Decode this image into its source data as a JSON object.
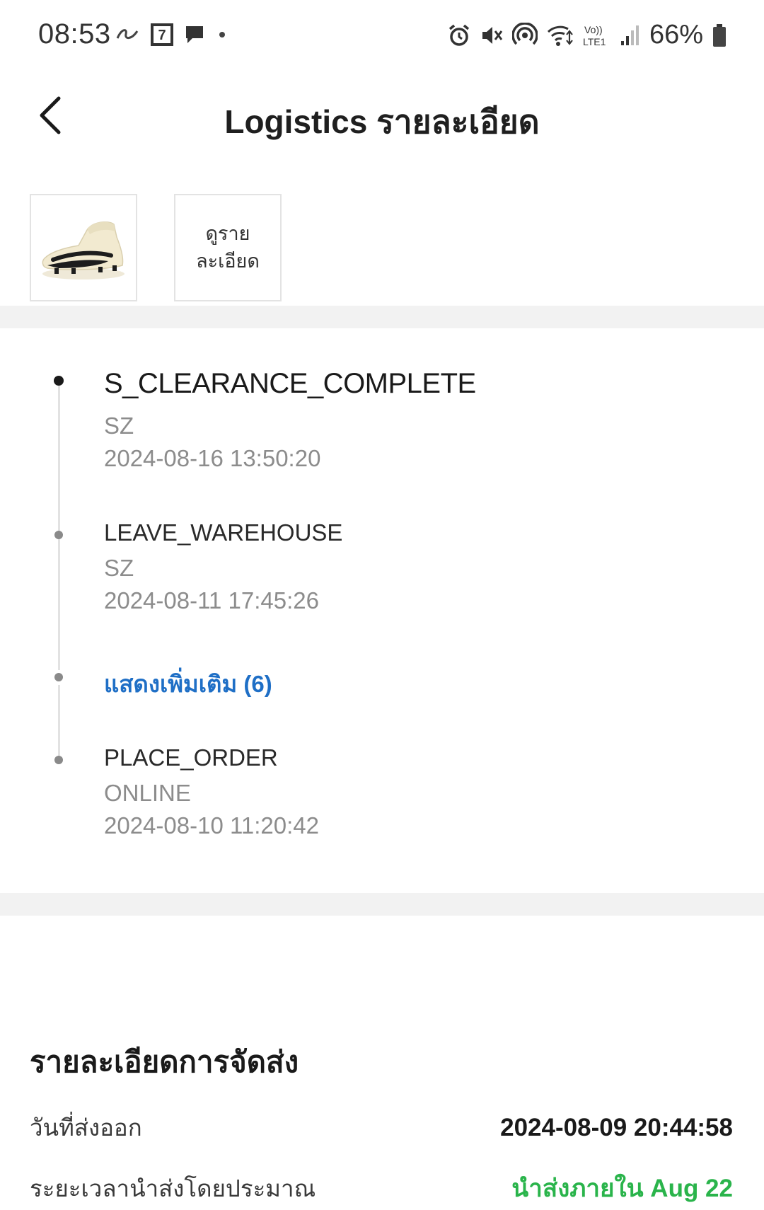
{
  "status_bar": {
    "time": "08:53",
    "battery": "66%",
    "left_icons": [
      "link-icon",
      "seven-eleven-icon",
      "chat-bubble-icon",
      "dot-icon"
    ],
    "right_icons": [
      "alarm-icon",
      "mute-icon",
      "hotspot-icon",
      "wifi-icon",
      "volte-icon",
      "signal-icon",
      "battery-icon"
    ],
    "volte_text": "Vo)) LTE1"
  },
  "header": {
    "title": "Logistics รายละเอียด"
  },
  "product": {
    "thumbnail_alt": "football boot",
    "view_details_label": "ดูรายละเอียด"
  },
  "timeline": {
    "events": [
      {
        "status": "S_CLEARANCE_COMPLETE",
        "location": "SZ",
        "time": "2024-08-16 13:50:20"
      },
      {
        "status": "LEAVE_WAREHOUSE",
        "location": "SZ",
        "time": "2024-08-11 17:45:26"
      },
      {
        "status": "PLACE_ORDER",
        "location": "ONLINE",
        "time": "2024-08-10 11:20:42"
      }
    ],
    "show_more_label": "แสดงเพิ่มเติม (6)"
  },
  "shipping": {
    "title": "รายละเอียดการจัดส่ง",
    "rows": [
      {
        "label": "วันที่ส่งออก",
        "value": "2024-08-09 20:44:58"
      },
      {
        "label": "ระยะเวลานำส่งโดยประมาณ",
        "value": "นำส่งภายใน Aug 22"
      }
    ]
  },
  "colors": {
    "accent_link": "#1f6fc6",
    "eta_green": "#2ab44b",
    "divider": "#f2f2f2"
  }
}
